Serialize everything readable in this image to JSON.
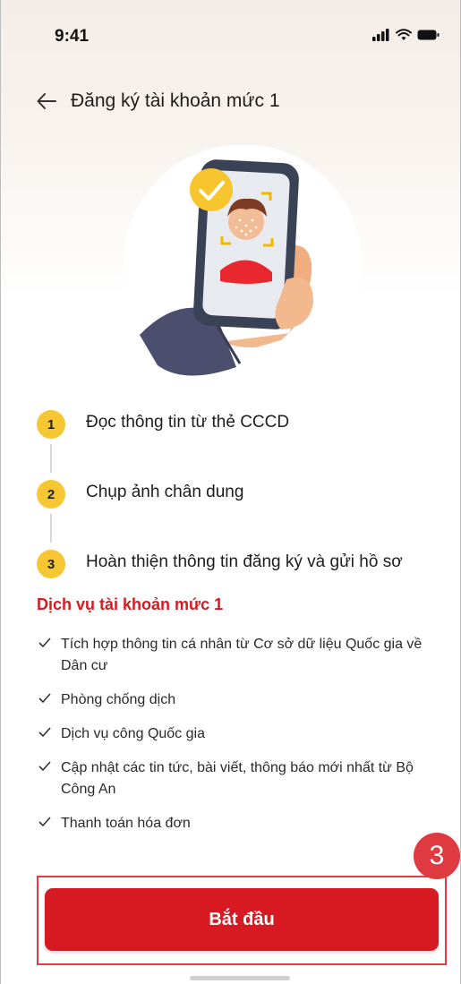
{
  "status_bar": {
    "time": "9:41"
  },
  "header": {
    "title": "Đăng ký tài khoản mức 1"
  },
  "steps": [
    {
      "number": "1",
      "label": "Đọc thông tin từ thẻ CCCD"
    },
    {
      "number": "2",
      "label": "Chụp ảnh chân dung"
    },
    {
      "number": "3",
      "label": "Hoàn thiện thông tin đăng ký và gửi hồ sơ"
    }
  ],
  "services": {
    "title": "Dịch vụ tài khoản mức 1",
    "items": [
      "Tích hợp thông tin cá nhân từ Cơ sở dữ liệu Quốc gia về Dân cư",
      "Phòng chống dịch",
      "Dịch vụ công Quốc gia",
      "Cập nhật các tin tức, bài viết, thông báo mới nhất từ Bộ Công An",
      "Thanh toán hóa đơn"
    ]
  },
  "cta": {
    "label": "Bắt đầu"
  },
  "annotation": {
    "badge": "3"
  },
  "colors": {
    "primary": "#d71a21",
    "step_circle": "#f7c633",
    "highlight": "#e23b43"
  },
  "icons": [
    "back-arrow-icon",
    "signal-icon",
    "wifi-icon",
    "battery-icon",
    "checkmark-icon",
    "face-scan-illustration"
  ]
}
